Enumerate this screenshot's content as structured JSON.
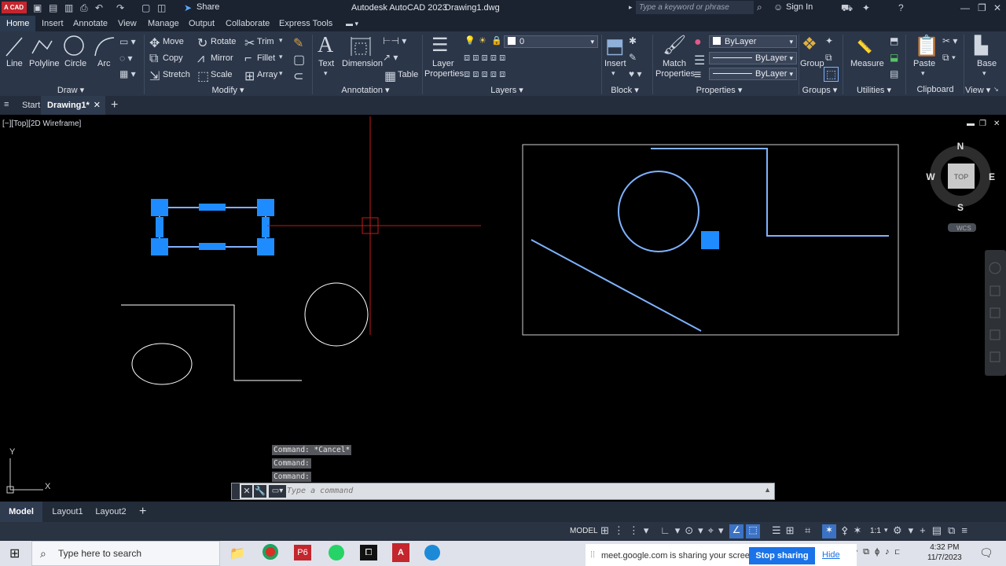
{
  "titlebar": {
    "logo": "A CAD",
    "share": "Share",
    "app_title": "Autodesk AutoCAD 2023",
    "file_name": "Drawing1.dwg",
    "search_placeholder": "Type a keyword or phrase",
    "sign_in": "Sign In"
  },
  "ribbon_tabs": [
    "Home",
    "Insert",
    "Annotate",
    "View",
    "Manage",
    "Output",
    "Collaborate",
    "Express Tools"
  ],
  "ribbon": {
    "draw": {
      "line": "Line",
      "polyline": "Polyline",
      "circle": "Circle",
      "arc": "Arc",
      "panel": "Draw ▾"
    },
    "modify": {
      "move": "Move",
      "rotate": "Rotate",
      "trim": "Trim",
      "copy": "Copy",
      "mirror": "Mirror",
      "fillet": "Fillet",
      "stretch": "Stretch",
      "scale": "Scale",
      "array": "Array",
      "panel": "Modify ▾"
    },
    "annotation": {
      "text": "Text",
      "dimension": "Dimension",
      "table": "Table",
      "panel": "Annotation ▾"
    },
    "layers": {
      "layer_properties_1": "Layer",
      "layer_properties_2": "Properties",
      "current_layer": "0",
      "panel": "Layers ▾"
    },
    "block": {
      "insert": "Insert",
      "panel": "Block ▾"
    },
    "properties": {
      "match_1": "Match",
      "match_2": "Properties",
      "color": "ByLayer",
      "linetype": "ByLayer",
      "lineweight": "ByLayer",
      "panel": "Properties ▾"
    },
    "groups": {
      "group": "Group",
      "panel": "Groups ▾"
    },
    "utilities": {
      "measure": "Measure",
      "panel": "Utilities ▾"
    },
    "clipboard": {
      "paste": "Paste",
      "panel": "Clipboard"
    },
    "view": {
      "base": "Base",
      "panel": "View ▾"
    }
  },
  "doc_tabs": {
    "start": "Start",
    "drawing": "Drawing1*"
  },
  "viewport": {
    "label": "[−][Top][2D Wireframe]",
    "viewcube": {
      "n": "N",
      "s": "S",
      "e": "E",
      "w": "W",
      "top": "TOP",
      "wcs": "WCS"
    },
    "ucs": {
      "x": "X",
      "y": "Y"
    }
  },
  "command": {
    "history": [
      "Command: *Cancel*",
      "Command:",
      "Command:"
    ],
    "placeholder": "Type a command"
  },
  "layout_tabs": [
    "Model",
    "Layout1",
    "Layout2"
  ],
  "statusbar": {
    "model": "MODEL",
    "scale": "1:1"
  },
  "taskbar": {
    "search_placeholder": "Type here to search",
    "share_message": "meet.google.com is sharing your screen.",
    "stop_sharing": "Stop sharing",
    "hide": "Hide",
    "time": "4:32 PM",
    "date": "11/7/2023"
  },
  "colors": {
    "selection": "#1e8cff",
    "crosshair": "#c21a1a",
    "preview_line": "#7fb2ff",
    "drawing": "#ffffff"
  }
}
